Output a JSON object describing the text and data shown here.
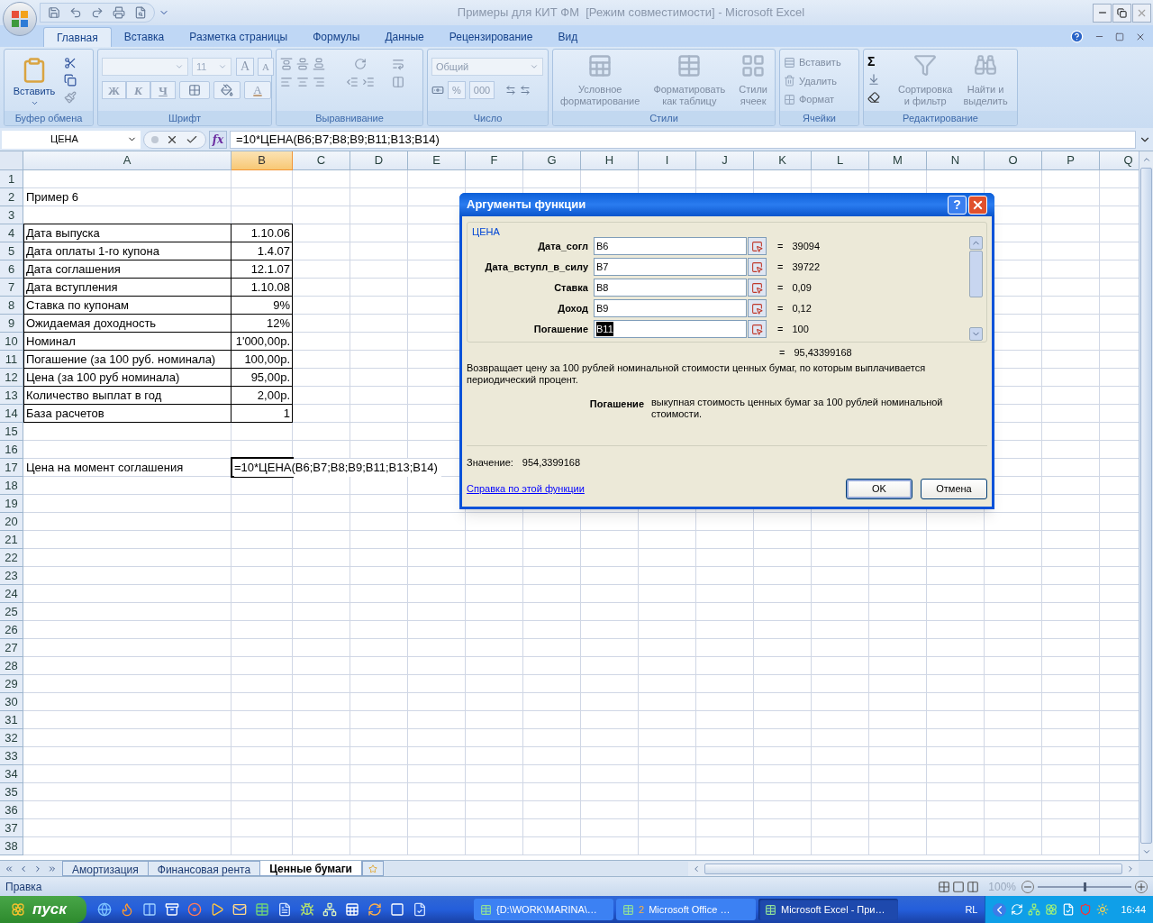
{
  "window": {
    "title": "Примеры для КИТ ФМ  [Режим совместимости] - Microsoft Excel"
  },
  "ribbon_tabs": [
    {
      "label": "Главная",
      "selected": true
    },
    {
      "label": "Вставка",
      "selected": false
    },
    {
      "label": "Разметка страницы",
      "selected": false
    },
    {
      "label": "Формулы",
      "selected": false
    },
    {
      "label": "Данные",
      "selected": false
    },
    {
      "label": "Рецензирование",
      "selected": false
    },
    {
      "label": "Вид",
      "selected": false
    }
  ],
  "clipboard": {
    "group": "Буфер обмена",
    "paste": "Вставить",
    "disabled": false
  },
  "font": {
    "group": "Шрифт",
    "size": "11",
    "grow": "A",
    "shrink": "A",
    "bold": "Ж",
    "italic": "К",
    "underline": "Ч",
    "color_button": "A",
    "disabled": true
  },
  "alignment": {
    "group": "Выравнивание",
    "disabled": true
  },
  "number": {
    "group": "Число",
    "format": "Общий",
    "percent": "%",
    "thousands": "000",
    "disabled": true
  },
  "styles": {
    "group": "Стили",
    "disabled": true,
    "buttons": [
      {
        "lines": [
          "Условное",
          "форматирование"
        ]
      },
      {
        "lines": [
          "Форматировать",
          "как таблицу"
        ]
      },
      {
        "lines": [
          "Стили",
          "ячеек"
        ]
      }
    ]
  },
  "cells": {
    "group": "Ячейки",
    "disabled": true,
    "buttons": [
      "Вставить",
      "Удалить",
      "Формат"
    ]
  },
  "editing": {
    "group": "Редактирование",
    "sum": "Σ",
    "disabled": true,
    "buttons": [
      {
        "lines": [
          "Сортировка",
          "и фильтр"
        ]
      },
      {
        "lines": [
          "Найти и",
          "выделить"
        ]
      }
    ]
  },
  "formula_bar": {
    "name_box": "ЦЕНА",
    "fx": "fx",
    "formula": "=10*ЦЕНА(B6;B7;B8;B9;B11;B13;B14)"
  },
  "columns": [
    {
      "label": "A",
      "selected": false
    },
    {
      "label": "B",
      "selected": true
    },
    {
      "label": "C",
      "selected": false
    },
    {
      "label": "D",
      "selected": false
    },
    {
      "label": "E",
      "selected": false
    },
    {
      "label": "F",
      "selected": false
    },
    {
      "label": "G",
      "selected": false
    },
    {
      "label": "H",
      "selected": false
    },
    {
      "label": "I",
      "selected": false
    },
    {
      "label": "J",
      "selected": false
    },
    {
      "label": "K",
      "selected": false
    },
    {
      "label": "L",
      "selected": false
    },
    {
      "label": "M",
      "selected": false
    },
    {
      "label": "N",
      "selected": false
    },
    {
      "label": "O",
      "selected": false
    },
    {
      "label": "P",
      "selected": false
    },
    {
      "label": "Q",
      "selected": false
    }
  ],
  "rows": [
    {
      "number": "1",
      "kind": "blank"
    },
    {
      "number": "2",
      "kind": "text",
      "a": "Пример 6"
    },
    {
      "number": "3",
      "kind": "blank"
    },
    {
      "number": "4",
      "kind": "table",
      "a": "Дата выпуска",
      "b": "1.10.06"
    },
    {
      "number": "5",
      "kind": "table",
      "a": "Дата оплаты 1-го купона",
      "b": "1.4.07"
    },
    {
      "number": "6",
      "kind": "table",
      "a": "Дата соглашения",
      "b": "12.1.07"
    },
    {
      "number": "7",
      "kind": "table",
      "a": "Дата вступления",
      "b": "1.10.08"
    },
    {
      "number": "8",
      "kind": "table",
      "a": "Ставка по купонам",
      "b": "9%"
    },
    {
      "number": "9",
      "kind": "table",
      "a": "Ожидаемая доходность",
      "b": "12%"
    },
    {
      "number": "10",
      "kind": "table",
      "a": "Номинал",
      "b": "1'000,00р."
    },
    {
      "number": "11",
      "kind": "table",
      "a": "Погашение (за 100 руб. номинала)",
      "b": "100,00р."
    },
    {
      "number": "12",
      "kind": "table",
      "a": "Цена (за 100 руб номинала)",
      "b": "95,00р."
    },
    {
      "number": "13",
      "kind": "table",
      "a": "Количество выплат в год",
      "b": "2,00р."
    },
    {
      "number": "14",
      "kind": "table",
      "a": "База расчетов",
      "b": "1"
    },
    {
      "number": "15",
      "kind": "blank"
    },
    {
      "number": "16",
      "kind": "blank"
    },
    {
      "number": "17",
      "kind": "edit",
      "a": "Цена на момент соглашения",
      "b": "=10*ЦЕНА(B6;B7;B8;B9;B11;B13;B14)"
    },
    {
      "number": "18",
      "kind": "blank"
    },
    {
      "number": "19",
      "kind": "blank"
    },
    {
      "number": "20",
      "kind": "blank"
    },
    {
      "number": "21",
      "kind": "blank"
    },
    {
      "number": "22",
      "kind": "blank"
    },
    {
      "number": "23",
      "kind": "blank"
    },
    {
      "number": "24",
      "kind": "blank"
    },
    {
      "number": "25",
      "kind": "blank"
    },
    {
      "number": "26",
      "kind": "blank"
    },
    {
      "number": "27",
      "kind": "blank"
    },
    {
      "number": "28",
      "kind": "blank"
    },
    {
      "number": "29",
      "kind": "blank"
    },
    {
      "number": "30",
      "kind": "blank"
    },
    {
      "number": "31",
      "kind": "blank"
    },
    {
      "number": "32",
      "kind": "blank"
    },
    {
      "number": "33",
      "kind": "blank"
    },
    {
      "number": "34",
      "kind": "blank"
    },
    {
      "number": "35",
      "kind": "blank"
    },
    {
      "number": "36",
      "kind": "blank"
    },
    {
      "number": "37",
      "kind": "blank"
    },
    {
      "number": "38",
      "kind": "blank"
    }
  ],
  "dialog": {
    "title": "Аргументы функции",
    "help": "?",
    "function_name": "ЦЕНА",
    "arguments": [
      {
        "label": "Дата_согл",
        "value": "B6",
        "eq": "=",
        "result": "39094",
        "selected": false
      },
      {
        "label": "Дата_вступл_в_силу",
        "value": "B7",
        "eq": "=",
        "result": "39722",
        "selected": false
      },
      {
        "label": "Ставка",
        "value": "B8",
        "eq": "=",
        "result": "0,09",
        "selected": false
      },
      {
        "label": "Доход",
        "value": "B9",
        "eq": "=",
        "result": "0,12",
        "selected": false
      },
      {
        "label": "Погашение",
        "value": "B11",
        "eq": "=",
        "result": "100",
        "selected": true
      }
    ],
    "total_eq": "=",
    "total": "95,43399168",
    "description": "Возвращает цену за 100 рублей номинальной стоимости ценных бумаг, по которым выплачивается периодический процент.",
    "param_name": "Погашение",
    "param_description": "выкупная стоимость ценных бумаг за 100 рублей номинальной стоимости.",
    "value_label": "Значение:",
    "value": "954,3399168",
    "help_link": "Справка по этой функции",
    "buttons": [
      {
        "label": "OK",
        "default": true
      },
      {
        "label": "Отмена",
        "default": false
      }
    ]
  },
  "sheet_tabs": [
    {
      "label": "Амортизация",
      "selected": false
    },
    {
      "label": "Финансовая рента",
      "selected": false
    },
    {
      "label": "Ценные бумаги",
      "selected": true
    }
  ],
  "status_bar": {
    "mode": "Правка",
    "zoom": "100%",
    "zoom_slider": {
      "level": 0.5
    }
  },
  "taskbar": {
    "start": "пуск",
    "tasks": [
      {
        "label": "{D:\\WORK\\MARINA\\…",
        "selected": false
      },
      {
        "count": "2",
        "label": "Microsoft Office …",
        "selected": false
      },
      {
        "label": "Microsoft Excel - При…",
        "selected": true
      }
    ],
    "language": "RL",
    "clock": "16:44"
  }
}
